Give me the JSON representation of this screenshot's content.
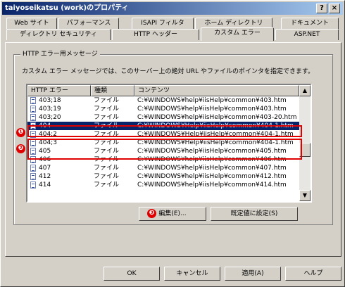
{
  "window": {
    "title": "taiyoseikatsu (work)のプロパティ",
    "help_button": "?",
    "close_button": "×"
  },
  "tabs": {
    "row1": [
      "Web サイト",
      "パフォーマンス",
      "ISAPI フィルタ",
      "ホーム ディレクトリ",
      "ドキュメント"
    ],
    "row2": [
      "ディレクトリ セキュリティ",
      "HTTP ヘッダー",
      "カスタム エラー",
      "ASP.NET"
    ],
    "active": "カスタム エラー"
  },
  "group": {
    "label": "HTTP エラー用メッセージ",
    "description": "カスタム エラー メッセージでは、このサーバー上の絶対 URL やファイルのポインタを指定できます。"
  },
  "list": {
    "columns": [
      "HTTP エラー",
      "種類",
      "コンテンツ"
    ],
    "rows": [
      {
        "error": "403;18",
        "type": "ファイル",
        "content": "C:¥WINDOWS¥help¥iisHelp¥common¥403.htm"
      },
      {
        "error": "403;19",
        "type": "ファイル",
        "content": "C:¥WINDOWS¥help¥iisHelp¥common¥403.htm"
      },
      {
        "error": "403;20",
        "type": "ファイル",
        "content": "C:¥WINDOWS¥help¥iisHelp¥common¥403-20.htm"
      },
      {
        "error": "404",
        "type": "ファイル",
        "content": "C:¥WINDOWS¥Help¥iisHelp¥common¥404-1.htm",
        "selected": true
      },
      {
        "error": "404;2",
        "type": "ファイル",
        "content": "C:¥WINDOWS¥Help¥iisHelp¥common¥404-1.htm"
      },
      {
        "error": "404;3",
        "type": "ファイル",
        "content": "C:¥WINDOWS¥Help¥iisHelp¥common¥404-1.htm"
      },
      {
        "error": "405",
        "type": "ファイル",
        "content": "C:¥WINDOWS¥help¥iisHelp¥common¥405.htm"
      },
      {
        "error": "406",
        "type": "ファイル",
        "content": "C:¥WINDOWS¥help¥iisHelp¥common¥406.htm"
      },
      {
        "error": "407",
        "type": "ファイル",
        "content": "C:¥WINDOWS¥help¥iisHelp¥common¥407.htm"
      },
      {
        "error": "412",
        "type": "ファイル",
        "content": "C:¥WINDOWS¥help¥iisHelp¥common¥412.htm"
      },
      {
        "error": "414",
        "type": "ファイル",
        "content": "C:¥WINDOWS¥help¥iisHelp¥common¥414.htm"
      }
    ]
  },
  "buttons": {
    "edit": "編集(E)...",
    "default": "既定値に設定(S)",
    "ok": "OK",
    "cancel": "キャンセル",
    "apply": "適用(A)",
    "help": "ヘルプ"
  },
  "annotations": [
    "❶",
    "❷",
    "❸"
  ],
  "colors": {
    "highlight": "#e00000",
    "selection": "#0a246a",
    "face": "#d4d0c8"
  }
}
